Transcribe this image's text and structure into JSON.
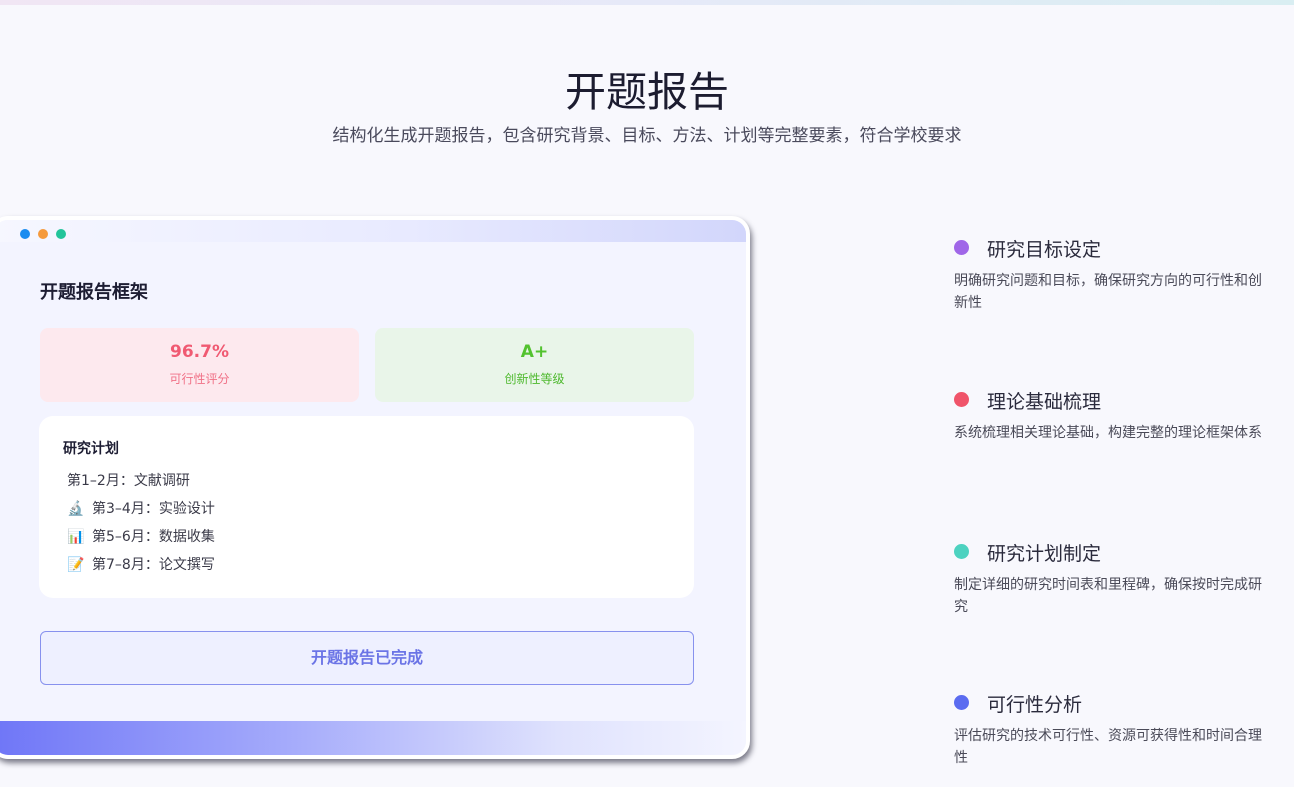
{
  "header": {
    "title": "开题报告",
    "subtitle": "结构化生成开题报告，包含研究背景、目标、方法、计划等完整要素，符合学校要求"
  },
  "window": {
    "frame_title": "开题报告框架",
    "metrics": [
      {
        "value": "96.7%",
        "label": "可行性评分"
      },
      {
        "value": "A+",
        "label": "创新性等级"
      }
    ],
    "plan": {
      "title": "研究计划",
      "items": [
        {
          "icon": "",
          "text": "第1–2月：文献调研"
        },
        {
          "icon": "🔬",
          "text": "第3–4月：实验设计"
        },
        {
          "icon": "📊",
          "text": "第5–6月：数据收集"
        },
        {
          "icon": "📝",
          "text": "第7–8月：论文撰写"
        }
      ]
    },
    "status": "开题报告已完成"
  },
  "features": [
    {
      "title": "研究目标设定",
      "desc": "明确研究问题和目标，确保研究方向的可行性和创新性",
      "color": "#a066e8"
    },
    {
      "title": "理论基础梳理",
      "desc": "系统梳理相关理论基础，构建完整的理论框架体系",
      "color": "#f0546a"
    },
    {
      "title": "研究计划制定",
      "desc": "制定详细的研究时间表和里程碑，确保按时完成研究",
      "color": "#4dd2c0"
    },
    {
      "title": "可行性分析",
      "desc": "评估研究的技术可行性、资源可获得性和时间合理性",
      "color": "#5b6cf0"
    }
  ]
}
